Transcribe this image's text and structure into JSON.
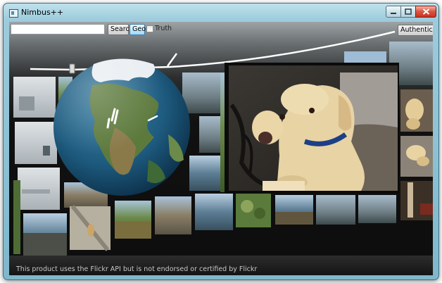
{
  "window": {
    "title": "Nimbus++"
  },
  "toolbar": {
    "search_value": "",
    "search_button": "Search",
    "geo_button": "Geo",
    "truth_label": "Truth",
    "truth_checked": false,
    "authenticate_button": "Authenticate"
  },
  "footer": {
    "notice": "This product uses the Flickr API but is not endorsed or certified by Flickr"
  },
  "main": {
    "photo_count": 29,
    "featured_photo": "dog-photo",
    "globe": "earth-globe"
  }
}
